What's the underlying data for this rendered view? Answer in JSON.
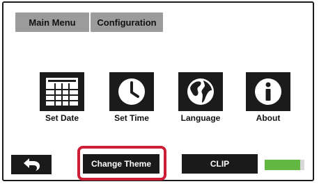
{
  "tabs": {
    "main_menu": "Main Menu",
    "configuration": "Configuration"
  },
  "tiles": [
    {
      "label": "Set Date",
      "icon": "calendar-icon"
    },
    {
      "label": "Set Time",
      "icon": "clock-icon"
    },
    {
      "label": "Language",
      "icon": "globe-icon"
    },
    {
      "label": "About",
      "icon": "info-icon"
    }
  ],
  "bottom_bar": {
    "back_icon": "back-arrow-icon",
    "change_theme_label": "Change Theme",
    "clip_label": "CLIP",
    "level_fraction": 0.9
  },
  "colors": {
    "tab_bg": "#9b9b9b",
    "button_bg": "#1a1a1a",
    "highlight": "#cc1f35",
    "meter_green": "#63b844"
  }
}
